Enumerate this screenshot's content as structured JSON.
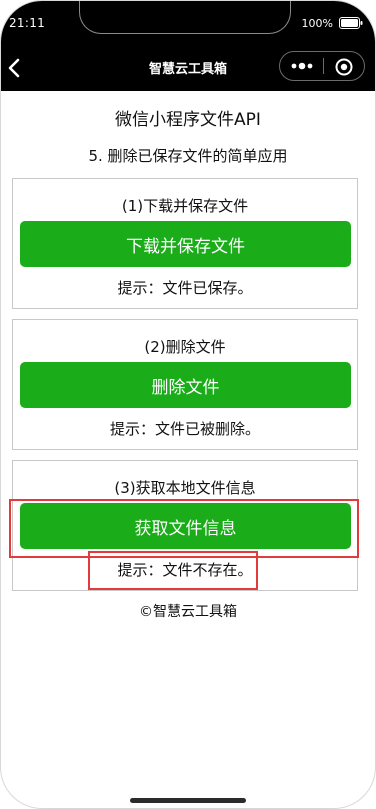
{
  "status_bar": {
    "time": "21:11",
    "battery": "100%"
  },
  "nav": {
    "title": "智慧云工具箱"
  },
  "page": {
    "title": "微信小程序文件API",
    "subtitle": "5. 删除已保存文件的简单应用"
  },
  "cards": [
    {
      "title": "(1)下载并保存文件",
      "button": "下载并保存文件",
      "hint": "提示：文件已保存。"
    },
    {
      "title": "(2)删除文件",
      "button": "删除文件",
      "hint": "提示：文件已被删除。"
    },
    {
      "title": "(3)获取本地文件信息",
      "button": "获取文件信息",
      "hint": "提示：文件不存在。"
    }
  ],
  "footer": "©智慧云工具箱",
  "colors": {
    "button_green": "#1aad19",
    "highlight_red": "#e23b3b",
    "nav_black": "#000000"
  },
  "icons": {
    "back": "back-arrow-icon",
    "more": "more-dots-icon",
    "close": "close-mini-program-icon",
    "battery": "battery-icon"
  }
}
